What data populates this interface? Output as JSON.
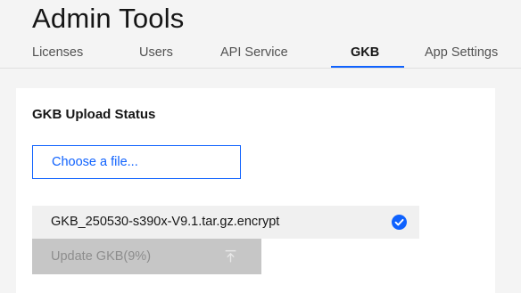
{
  "header": {
    "title": "Admin Tools"
  },
  "tabs": [
    {
      "label": "Licenses",
      "active": false
    },
    {
      "label": "Users",
      "active": false
    },
    {
      "label": "API Service",
      "active": false
    },
    {
      "label": "GKB",
      "active": true
    },
    {
      "label": "App Settings",
      "active": false
    }
  ],
  "panel": {
    "title": "GKB Upload Status",
    "choose_file_label": "Choose a file...",
    "file_name": "GKB_250530-s390x-V9.1.tar.gz.encrypt",
    "file_status_icon": "checkmark-filled-icon",
    "update_button_label": "Update GKB(9%)",
    "update_button_icon": "upload-icon",
    "upload_progress_percent": 9
  },
  "colors": {
    "accent": "#0f62fe",
    "background": "#f4f4f4",
    "panel": "#ffffff",
    "disabled_button": "#c6c6c6",
    "disabled_text": "#8d8d8d"
  }
}
